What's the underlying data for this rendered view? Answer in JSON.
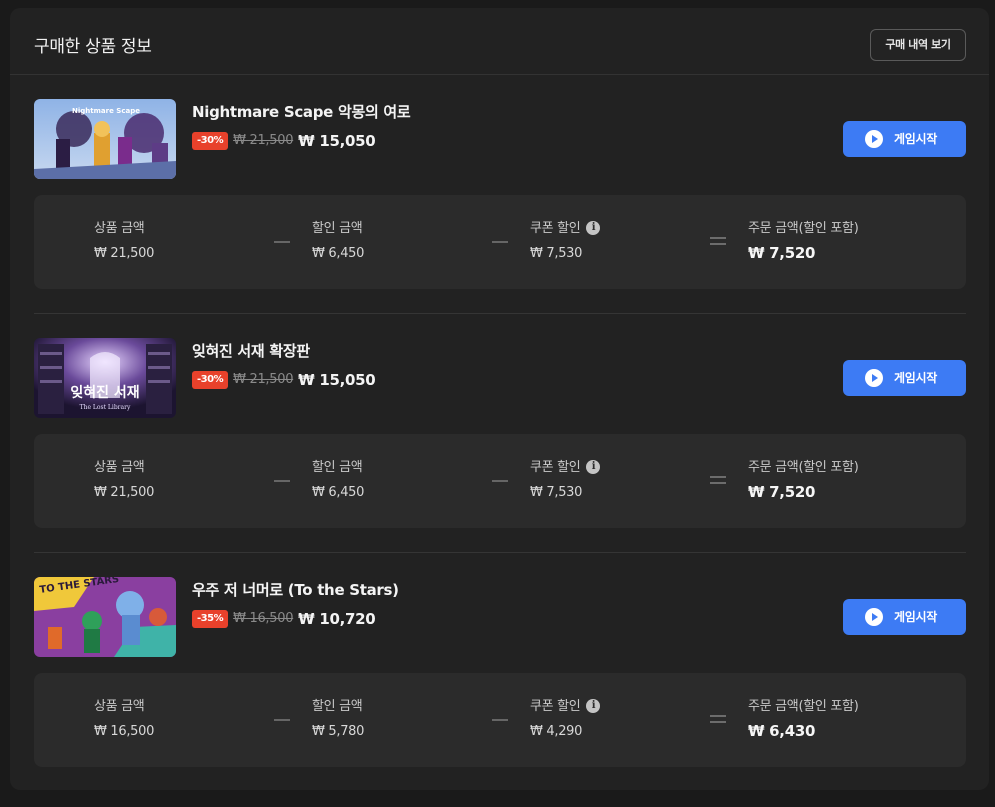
{
  "header": {
    "title": "구매한 상품 정보",
    "history_button": "구매 내역 보기"
  },
  "labels": {
    "product_amount": "상품 금액",
    "discount_amount": "할인 금액",
    "coupon_discount": "쿠폰 할인",
    "order_amount": "주문 금액(할인 포함)",
    "play_button": "게임시작",
    "info_icon": "i"
  },
  "items": [
    {
      "title": "Nightmare Scape 악몽의 여로",
      "discount_badge": "-30%",
      "original_price": "₩ 21,500",
      "sale_price": "₩ 15,050",
      "product_amount": "₩ 21,500",
      "discount_amount": "₩ 6,450",
      "coupon_discount": "₩ 7,530",
      "order_amount": "₩ 7,520",
      "thumbnail_text": "Nightmare Scape"
    },
    {
      "title": "잊혀진 서재 확장판",
      "discount_badge": "-30%",
      "original_price": "₩ 21,500",
      "sale_price": "₩ 15,050",
      "product_amount": "₩ 21,500",
      "discount_amount": "₩ 6,450",
      "coupon_discount": "₩ 7,530",
      "order_amount": "₩ 7,520",
      "thumbnail_text": "잊혀진 서재",
      "thumbnail_subtext": "The Lost Library"
    },
    {
      "title": "우주 저 너머로 (To the Stars)",
      "discount_badge": "-35%",
      "original_price": "₩ 16,500",
      "sale_price": "₩ 10,720",
      "product_amount": "₩ 16,500",
      "discount_amount": "₩ 5,780",
      "coupon_discount": "₩ 4,290",
      "order_amount": "₩ 6,430",
      "thumbnail_text": "TO THE STARS"
    }
  ],
  "colors": {
    "accent": "#3d7bf4",
    "badge": "#e8412b",
    "panel": "#222222",
    "card": "#2b2b2b"
  }
}
